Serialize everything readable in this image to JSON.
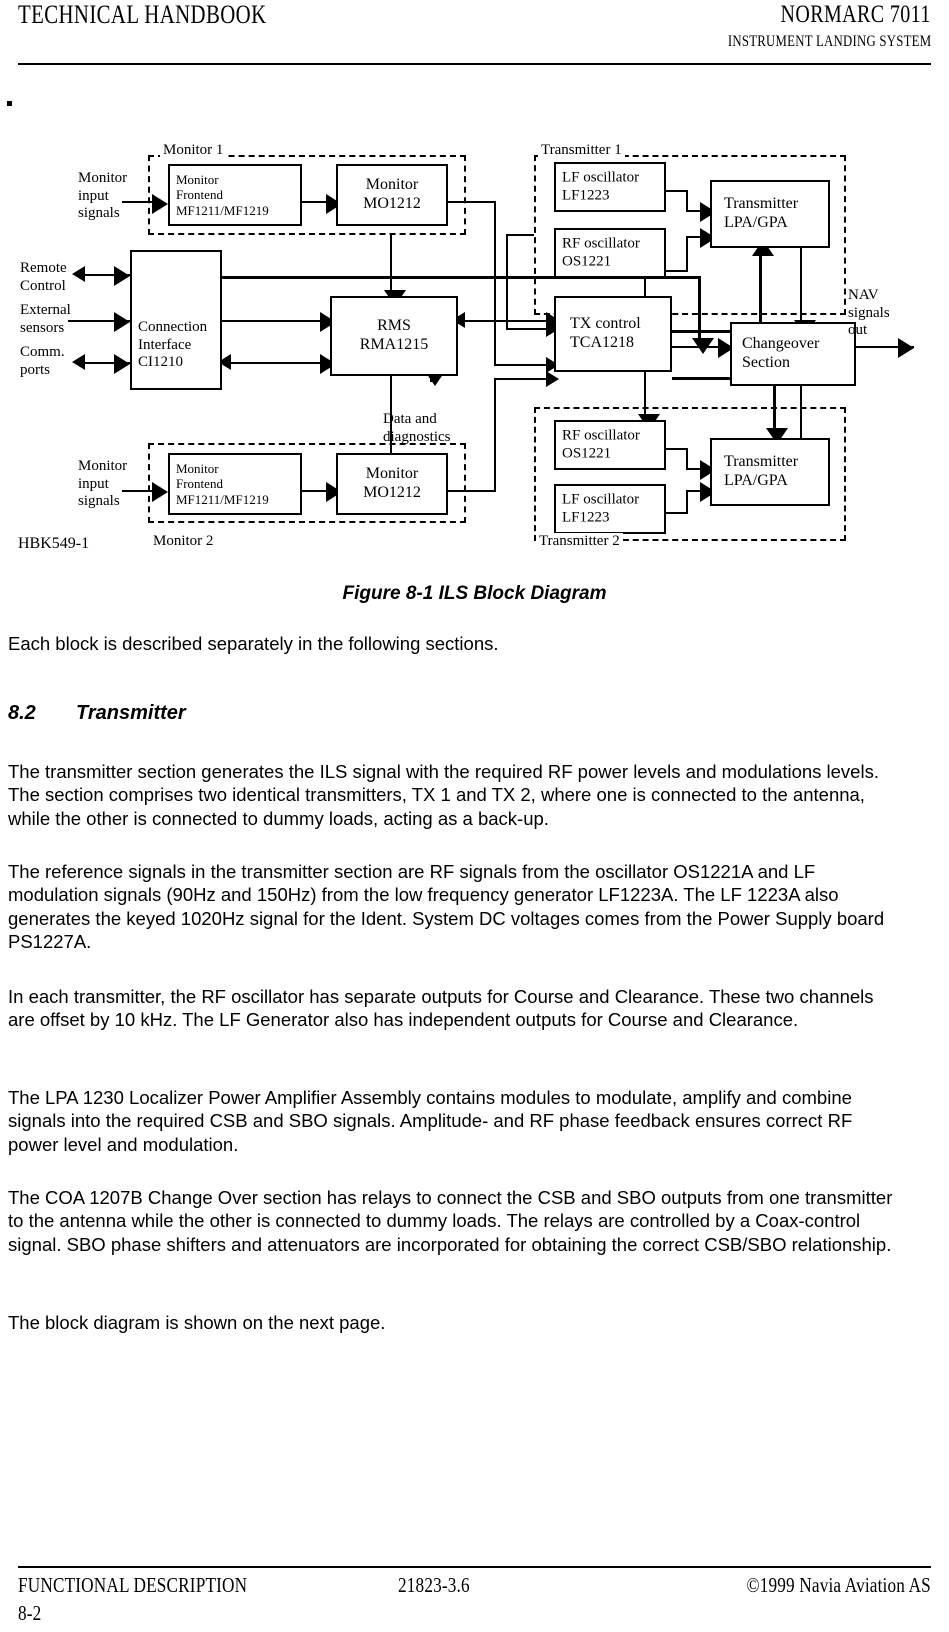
{
  "header": {
    "left": "TECHNICAL HANDBOOK",
    "right": "NORMARC 7011",
    "subtitle": "INSTRUMENT LANDING SYSTEM"
  },
  "stray_mark": ".",
  "figure": {
    "caption": "Figure 8-1 ILS Block Diagram",
    "drawing_id": "HBK549-1",
    "groups": {
      "monitor1": "Monitor 1",
      "monitor2": "Monitor 2",
      "transmitter1": "Transmitter 1",
      "transmitter2": "Transmitter 2"
    },
    "io_labels": {
      "monitor_input_top": "Monitor\ninput\nsignals",
      "monitor_input_bottom": "Monitor\ninput\nsignals",
      "remote_control": "Remote\nControl",
      "external_sensors": "External\nsensors",
      "comm_ports": "Comm.\nports",
      "nav_out": "NAV\nsignals\nout",
      "data_diag": "Data and\ndiagnostics"
    },
    "blocks": {
      "mon1_frontend": "Monitor\nFrontend\nMF1211/MF1219",
      "mon1_mo": "Monitor\nMO1212",
      "mon2_frontend": "Monitor\nFrontend\nMF1211/MF1219",
      "mon2_mo": "Monitor\nMO1212",
      "connection_interface": "Connection\nInterface\nCI1210",
      "rms": "RMS\nRMA1215",
      "tx_control": "TX control\nTCA1218",
      "changeover": "Changeover\nSection",
      "tx1_lf": "LF oscillator\nLF1223",
      "tx1_rf": "RF oscillator\nOS1221",
      "tx1_amp": "Transmitter\nLPA/GPA",
      "tx2_rf": "RF oscillator\nOS1221",
      "tx2_lf": "LF oscillator\nLF1223",
      "tx2_amp": "Transmitter\nLPA/GPA"
    }
  },
  "body": {
    "intro": "Each block is described separately in the following sections.",
    "section_number": "8.2",
    "section_title": "Transmitter",
    "p1": "The transmitter section generates the ILS signal with the required RF power levels and modulations levels. The section comprises two identical transmitters, TX 1 and TX 2, where one is connected to the antenna, while the other is connected to dummy loads, acting as a back-up.",
    "p2": "The reference signals in the transmitter section are RF signals from the oscillator OS1221A and LF modulation signals (90Hz and 150Hz) from the low frequency generator LF1223A. The LF 1223A also generates the keyed 1020Hz signal for the Ident. System DC voltages comes from the Power Supply board PS1227A.",
    "p3": "In each transmitter, the RF oscillator has separate outputs for Course and Clearance. These two channels are offset by 10 kHz. The LF Generator also has independent outputs for Course and Clearance.",
    "p4": "The LPA 1230 Localizer Power Amplifier Assembly contains modules to modulate, amplify and combine signals into the required CSB and SBO signals. Amplitude- and RF phase feedback ensures correct RF power level and modulation.",
    "p5": "The COA 1207B Change Over section has relays to connect the CSB and SBO outputs from one transmitter to the antenna while the other is connected to dummy loads. The relays are controlled by a Coax-control signal. SBO phase shifters and attenuators are incorporated for obtaining the correct CSB/SBO relationship.",
    "p6": "The block diagram is shown on the next page."
  },
  "footer": {
    "left": "FUNCTIONAL DESCRIPTION",
    "center": "21823-3.6",
    "right": "©1999 Navia Aviation AS",
    "page": "8-2"
  }
}
